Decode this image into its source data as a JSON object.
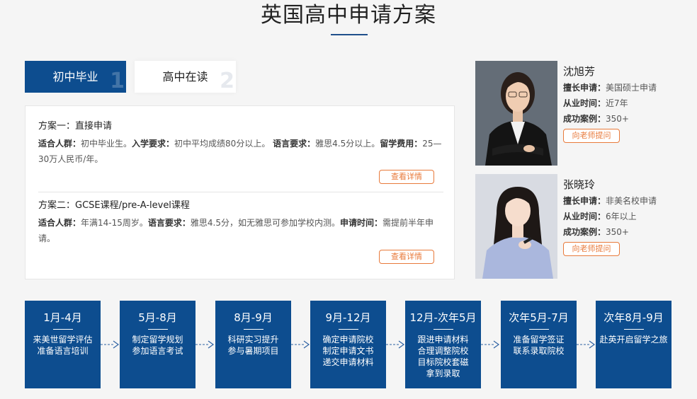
{
  "page": {
    "title": "英国高中申请方案"
  },
  "tabs": [
    {
      "label": "初中毕业",
      "num": "1"
    },
    {
      "label": "高中在读",
      "num": "2"
    }
  ],
  "plans": [
    {
      "title": "方案一：直接申请",
      "k1": "适合人群：",
      "v1": "初中毕业生。",
      "k2": "入学要求：",
      "v2": "初中平均成绩80分以上。",
      "k3": "语言要求：",
      "v3": "雅思4.5分以上。",
      "k4": "留学费用：",
      "v4": "25—30万人民币/年。",
      "button": "查看详情"
    },
    {
      "title": "方案二：GCSE课程/pre-A-level课程",
      "k1": "适合人群：",
      "v1": "年满14-15周岁。",
      "k2": "语言要求：",
      "v2": "雅思4.5分，如无雅思可参加学校内测。",
      "k3": "申请时间：",
      "v3": "需提前半年申请。",
      "button": "查看详情"
    }
  ],
  "advisors": [
    {
      "name": "沈旭芳",
      "specialty_label": "擅长申请：",
      "specialty": "美国硕士申请",
      "years_label": "从业时间：",
      "years": "近7年",
      "cases_label": "成功案例：",
      "cases": "350+",
      "button": "向老师提问"
    },
    {
      "name": "张晓玲",
      "specialty_label": "擅长申请：",
      "specialty": "非美名校申请",
      "years_label": "从业时间：",
      "years": "6年以上",
      "cases_label": "成功案例：",
      "cases": "350+",
      "button": "向老师提问"
    }
  ],
  "timeline": [
    {
      "period": "1月-4月",
      "text": "来美世留学评估\n准备语言培训"
    },
    {
      "period": "5月-8月",
      "text": "制定留学规划\n参加语言考试"
    },
    {
      "period": "8月-9月",
      "text": "科研实习提升\n参与暑期项目"
    },
    {
      "period": "9月-12月",
      "text": "确定申请院校\n制定申请文书\n递交申请材料"
    },
    {
      "period": "12月-次年5月",
      "text": "跟进申请材料\n合理调整院校\n目标院校套磁\n拿到录取"
    },
    {
      "period": "次年5月-7月",
      "text": "准备留学签证\n联系录取院校"
    },
    {
      "period": "次年8月-9月",
      "text": "赴英开启留学之旅"
    }
  ],
  "colors": {
    "primary": "#0d4d8f",
    "accent": "#e87a3b"
  }
}
